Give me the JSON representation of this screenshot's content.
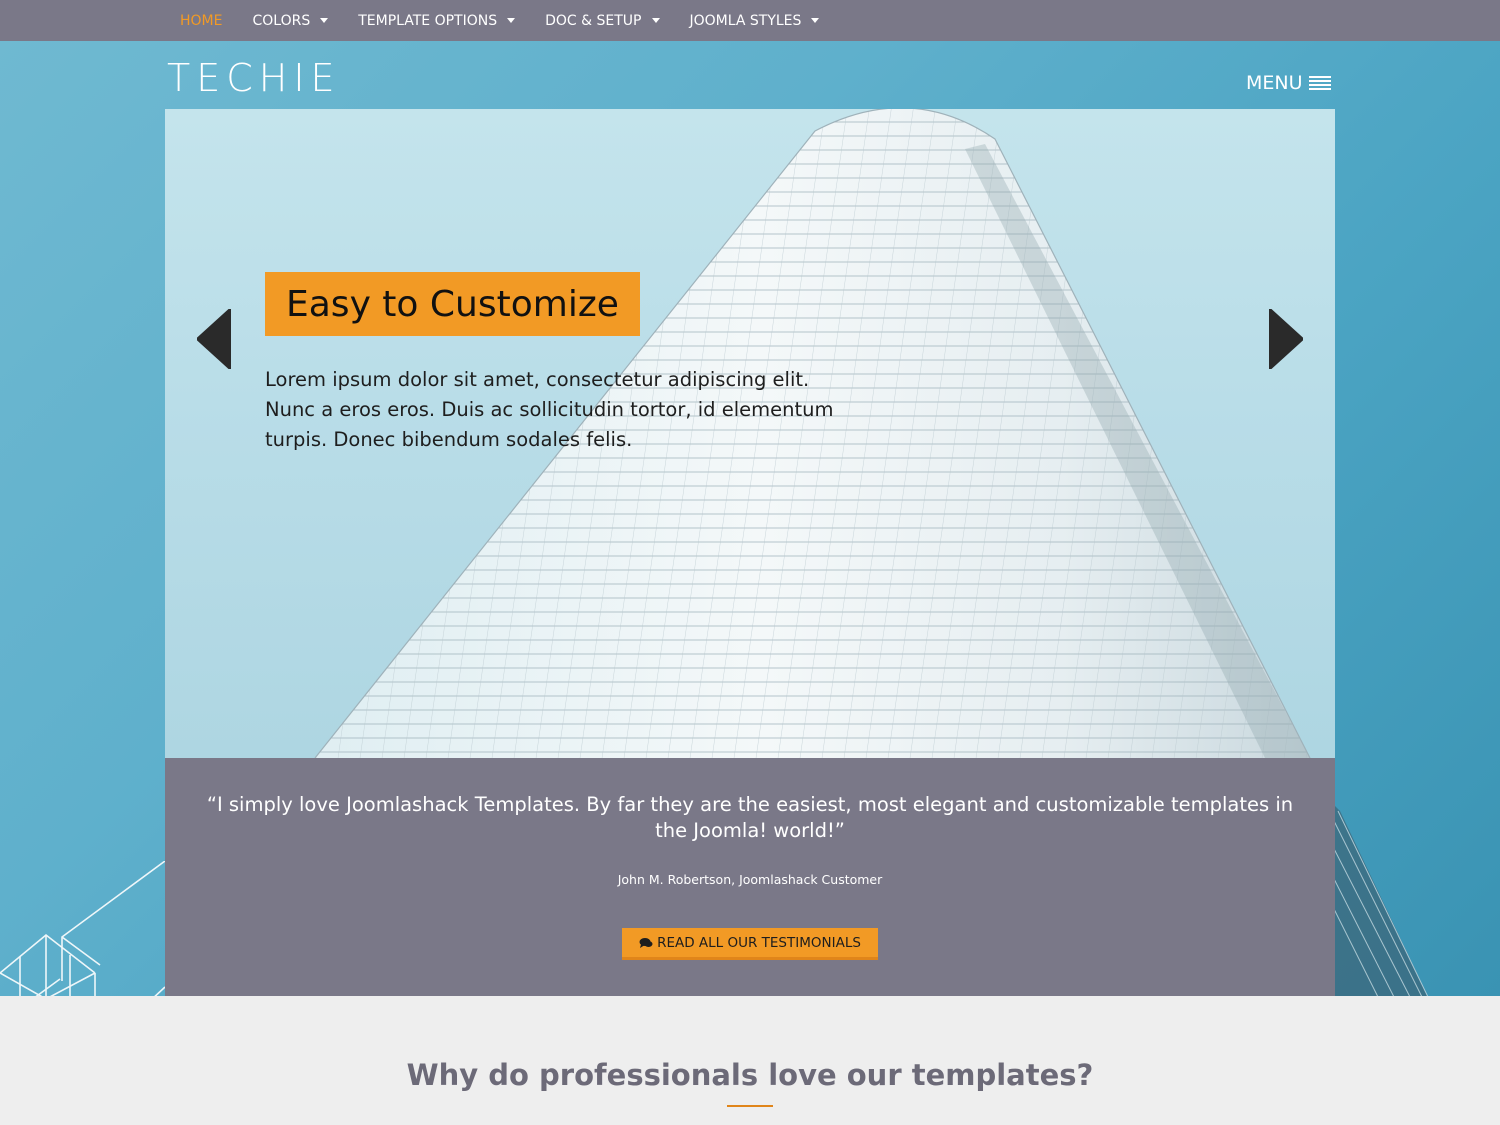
{
  "nav": {
    "items": [
      {
        "label": "HOME",
        "active": true,
        "dropdown": false
      },
      {
        "label": "COLORS",
        "active": false,
        "dropdown": true
      },
      {
        "label": "TEMPLATE OPTIONS",
        "active": false,
        "dropdown": true
      },
      {
        "label": "DOC & SETUP",
        "active": false,
        "dropdown": true
      },
      {
        "label": "JOOMLA STYLES",
        "active": false,
        "dropdown": true
      }
    ]
  },
  "header": {
    "logo": "TECHIE",
    "menu_label": "MENU",
    "menu_icon": "hamburger-icon"
  },
  "slider": {
    "title": "Easy to Customize",
    "text": "Lorem ipsum dolor sit amet, consectetur adipiscing elit. Nunc a eros eros. Duis ac sollicitudin tortor, id elementum turpis. Donec bibendum sodales felis.",
    "prev_icon": "chevron-left-icon",
    "next_icon": "chevron-right-icon"
  },
  "testimonial": {
    "quote": "“I simply love Joomlashack Templates. By far they are the easiest, most elegant and customizable templates in the Joomla! world!”",
    "author": "John M. Robertson, Joomlashack Customer",
    "button_label": "READ ALL OUR TESTIMONIALS",
    "button_icon": "comments-icon"
  },
  "section": {
    "title": "Why do professionals love our templates?"
  },
  "colors": {
    "accent": "#f29a25",
    "nav_bg": "#7a7888",
    "hero_blue": "#4ba4c3",
    "page_bg": "#eeeeee"
  }
}
